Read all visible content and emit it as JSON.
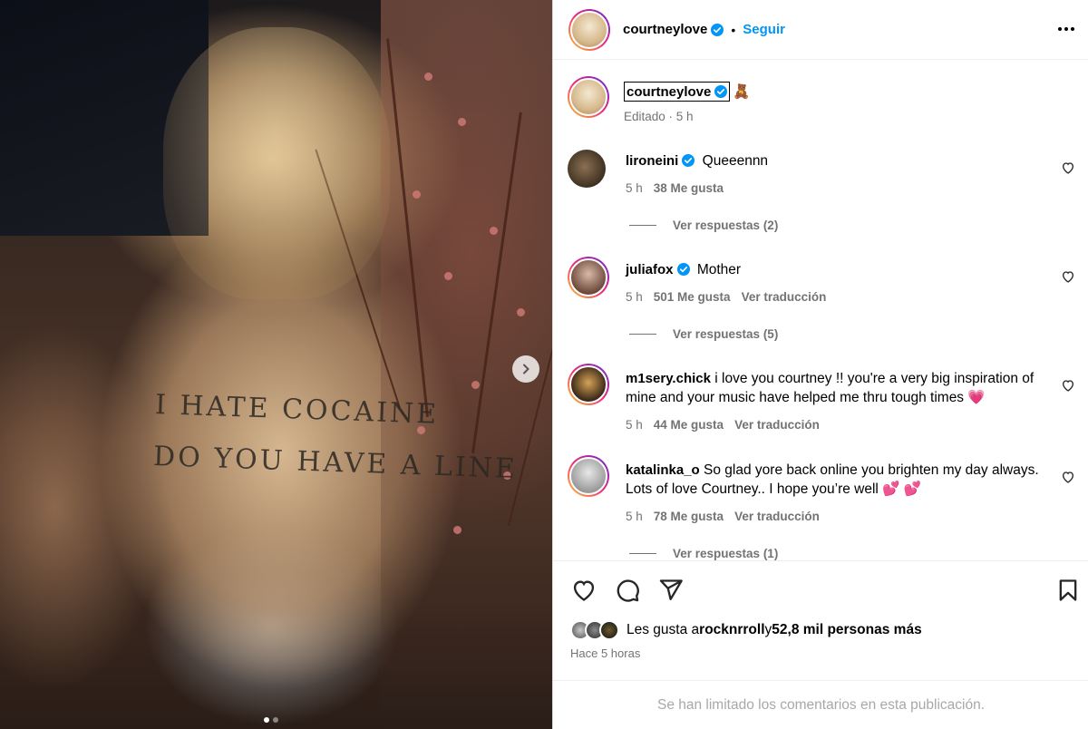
{
  "post": {
    "author": "courtneylove",
    "follow_label": "Seguir",
    "caption_emoji": "🧸",
    "edited_label": "Editado · 5 h"
  },
  "photo": {
    "shirt_lines": [
      "I HATE COCAINE",
      "DO YOU HAVE A LINE"
    ],
    "carousel_total": 2,
    "carousel_index": 1
  },
  "comments": [
    {
      "user": "lironeini",
      "text": "Queeennn",
      "time": "5 h",
      "likes": "38 Me gusta",
      "translate": "",
      "replies": "Ver respuestas (2)"
    },
    {
      "user": "juliafox",
      "text": "Mother",
      "time": "5 h",
      "likes": "501 Me gusta",
      "translate": "Ver traducción",
      "replies": "Ver respuestas (5)"
    },
    {
      "user": "m1sery.chick",
      "text": "i love you courtney !! you're a very big inspiration of mine and your music have helped me thru tough times 💗",
      "time": "5 h",
      "likes": "44 Me gusta",
      "translate": "Ver traducción",
      "replies": ""
    },
    {
      "user": "katalinka_o",
      "text": "So glad yore back online you brighten my day always. Lots of love Courtney.. I hope you’re well 💕 💕",
      "time": "5 h",
      "likes": "78 Me gusta",
      "translate": "Ver traducción",
      "replies": "Ver respuestas (1)"
    }
  ],
  "likes": {
    "prefix": "Les gusta a ",
    "user": "rocknrroll",
    "connector": " y ",
    "others": "52,8 mil personas más",
    "time_ago": "Hace 5 horas"
  },
  "footer": {
    "limited_text": "Se han limitado los comentarios en esta publicación."
  },
  "icons": {
    "verified_color": "#0095f6",
    "accent": "#0095f6",
    "pink_heart": "#e8467c"
  }
}
